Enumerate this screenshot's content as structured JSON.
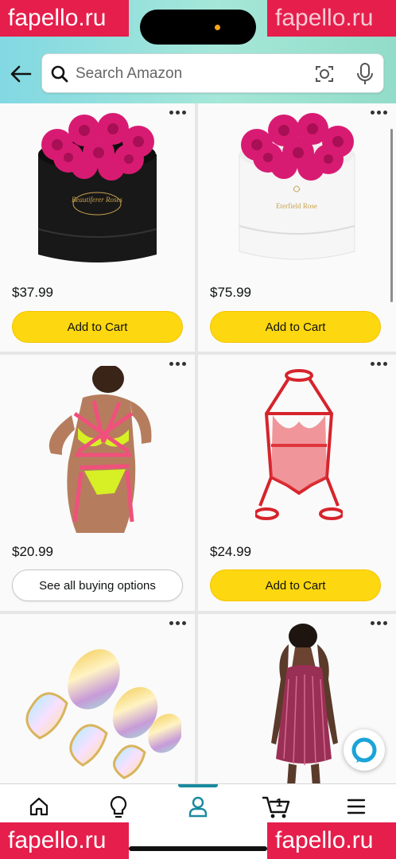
{
  "search": {
    "placeholder": "Search Amazon"
  },
  "watermark": {
    "text": "fapello.ru"
  },
  "products": [
    {
      "price": "$37.99",
      "action": "Add to Cart"
    },
    {
      "price": "$75.99",
      "action": "Add to Cart"
    },
    {
      "price": "$20.99",
      "action": "See all buying options"
    },
    {
      "price": "$24.99",
      "action": "Add to Cart"
    }
  ],
  "product_box_labels": {
    "black_box": "Beautiferer Roses",
    "white_box": "Eterfield Rose"
  },
  "cart": {
    "count": "1"
  },
  "colors": {
    "accent": "#1a8a9e",
    "button_yellow": "#fdd70f",
    "watermark": "#e51e4b"
  }
}
